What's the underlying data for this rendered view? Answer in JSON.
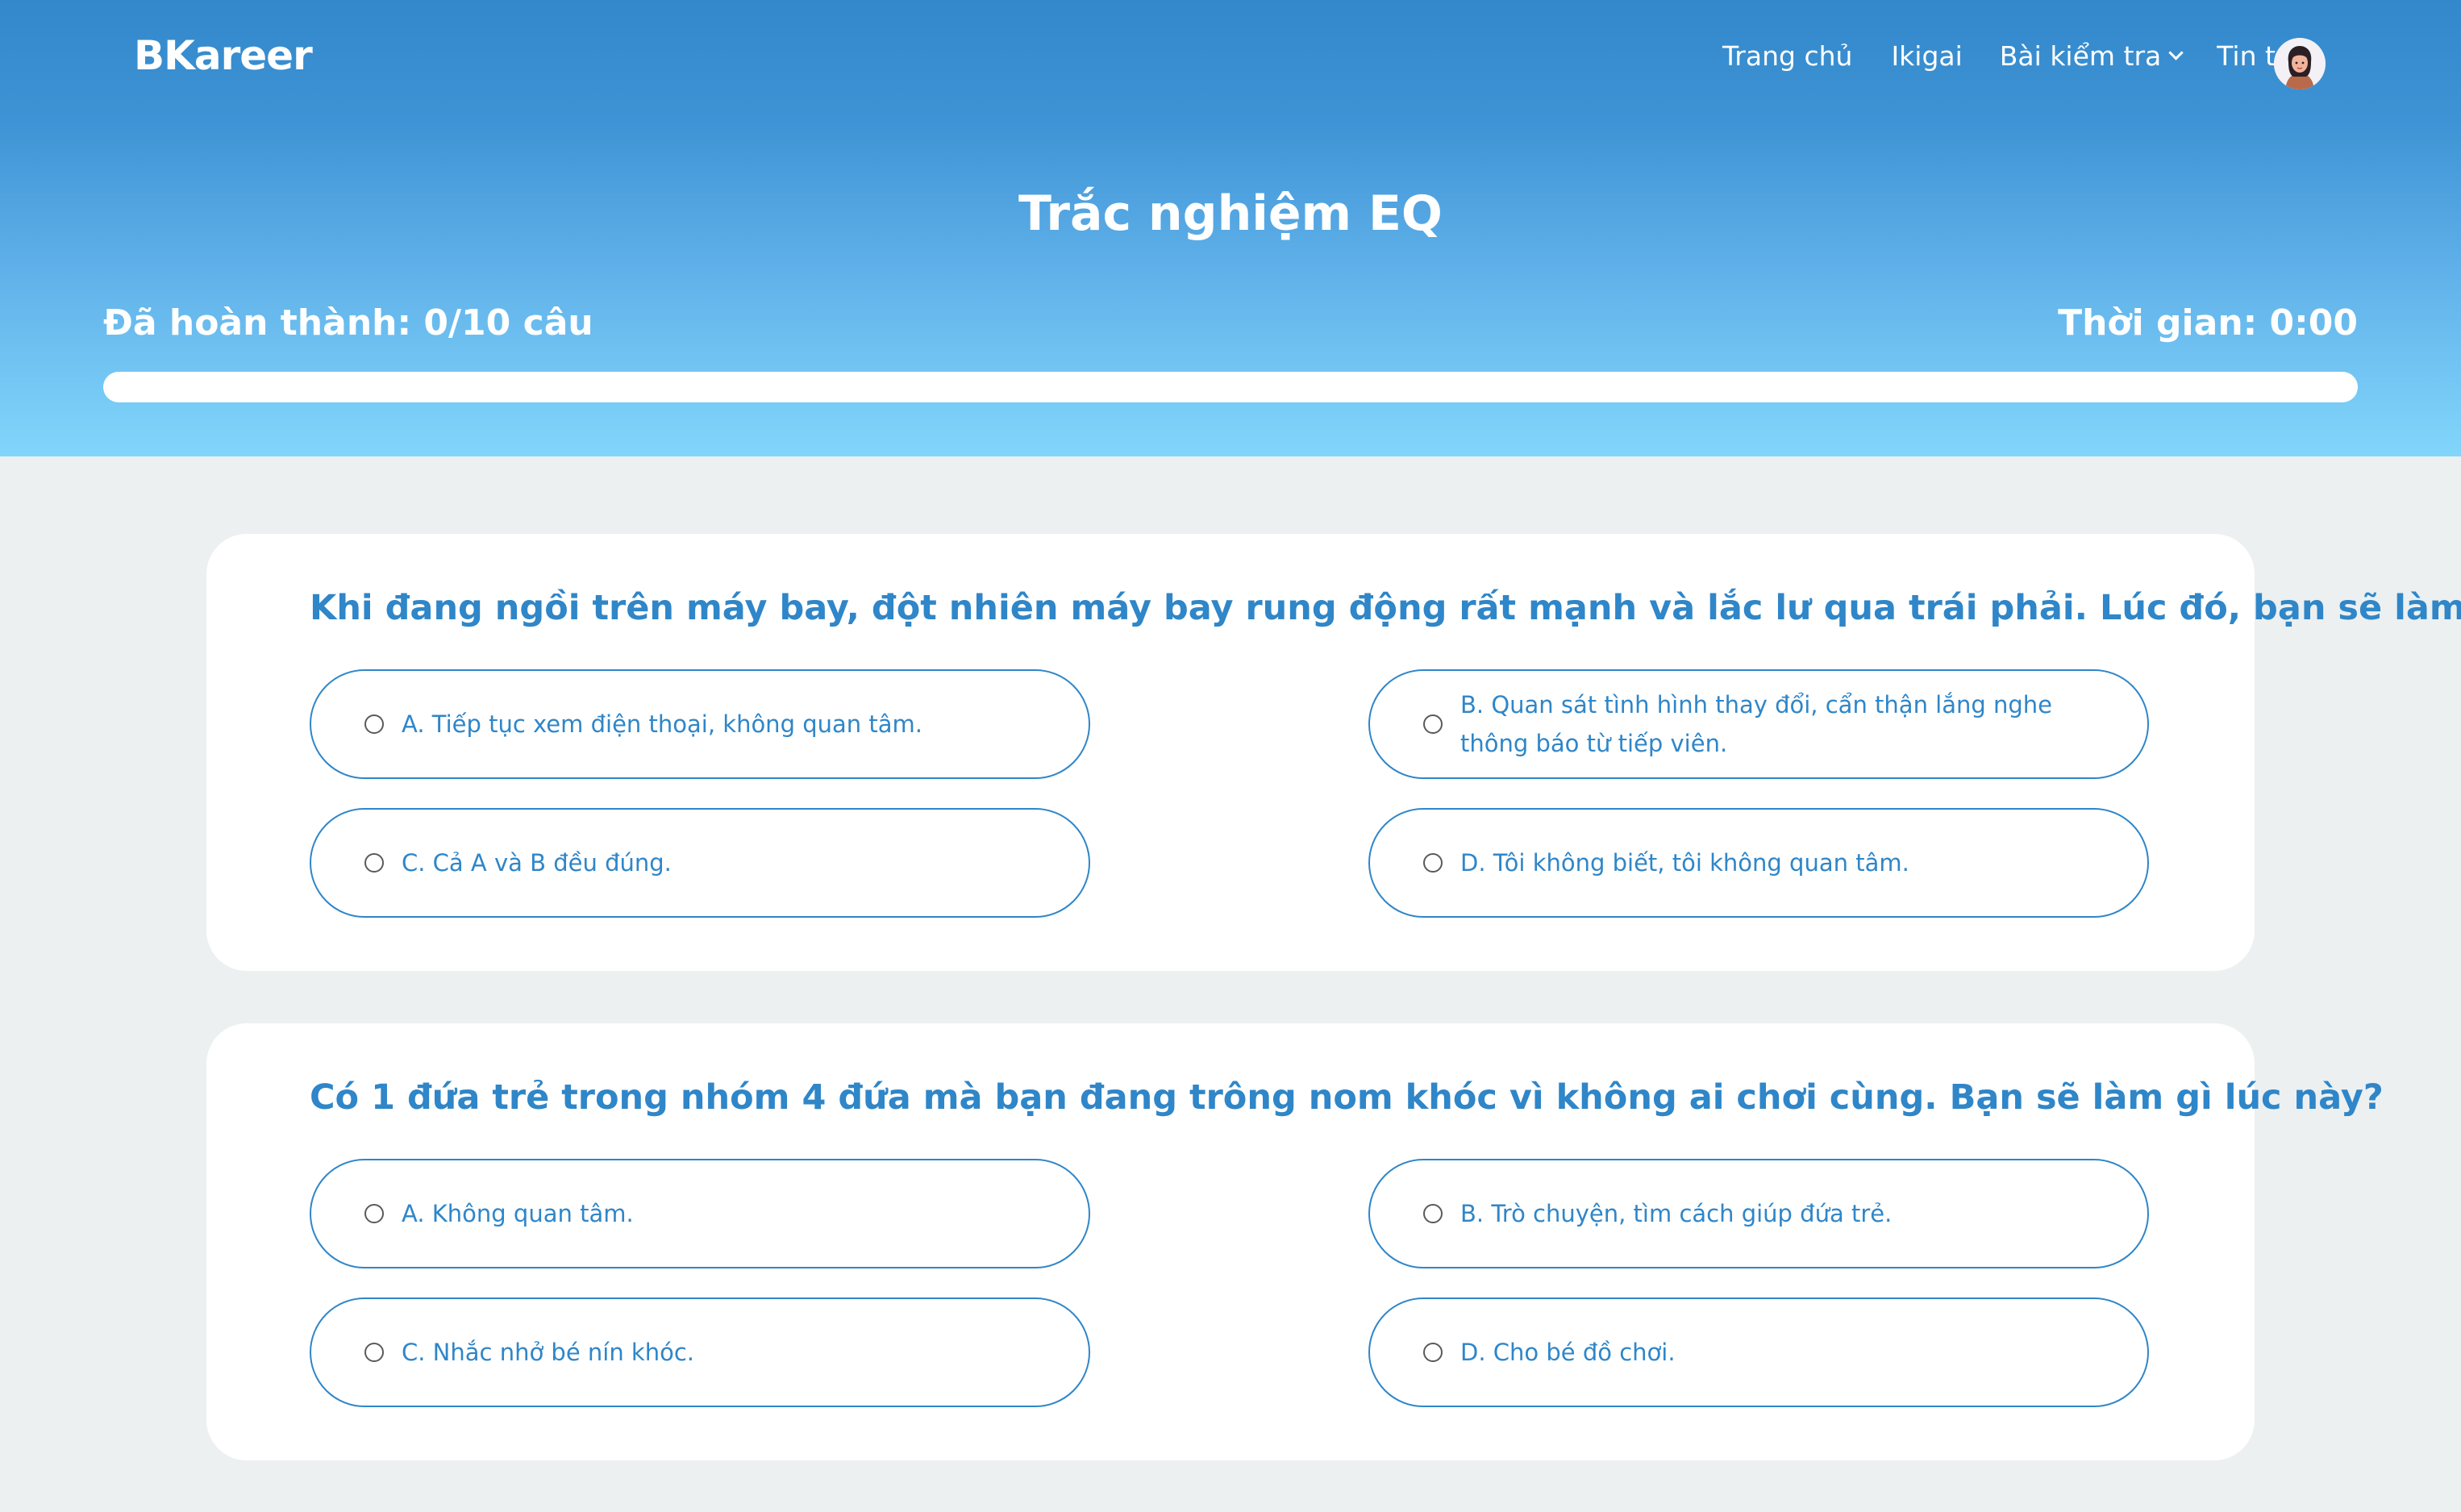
{
  "brand": "BKareer",
  "nav": {
    "home": "Trang chủ",
    "ikigai": "Ikigai",
    "tests": "Bài kiểm tra",
    "news": "Tin tức",
    "avatar_icon": "user-avatar-icon"
  },
  "page": {
    "title": "Trắc nghiệm EQ",
    "progress_text": "Đã hoàn thành: 0/10 câu",
    "progress_fraction": 0,
    "timer": "Thời gian: 0:00"
  },
  "colors": {
    "primary": "#2f86c8",
    "header_top": "#3388cb",
    "header_bottom": "#82d6fb",
    "page_background": "#ecf0f1"
  },
  "questions": [
    {
      "text": "Khi đang ngồi trên máy bay, đột nhiên máy bay rung động rất mạnh và lắc lư qua trái phải. Lúc đó, bạn sẽ làm gì?",
      "options": [
        "A. Tiếp tục xem điện thoại, không quan tâm.",
        "B. Quan sát tình hình thay đổi, cẩn thận lắng nghe thông báo từ tiếp viên.",
        "C. Cả A và B đều đúng.",
        "D. Tôi không biết, tôi không quan tâm."
      ]
    },
    {
      "text": "Có 1 đứa trẻ trong nhóm 4 đứa mà bạn đang trông nom khóc vì không ai chơi cùng. Bạn sẽ làm gì lúc này?",
      "options": [
        "A. Không quan tâm.",
        "B. Trò chuyện, tìm cách giúp đứa trẻ.",
        "C. Nhắc nhở bé nín khóc.",
        "D. Cho bé đồ chơi."
      ]
    }
  ]
}
